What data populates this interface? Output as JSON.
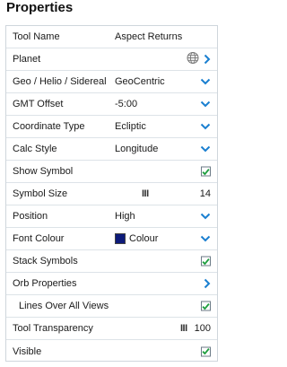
{
  "panel": {
    "title": "Properties",
    "accent_color": "#1a7fd0",
    "check_color": "#1e9e3e"
  },
  "rows": {
    "tool_name": {
      "label": "Tool Name",
      "value": "Aspect Returns"
    },
    "planet": {
      "label": "Planet",
      "icon": "globe-icon"
    },
    "geo": {
      "label": "Geo / Helio / Sidereal",
      "value": "GeoCentric"
    },
    "gmt": {
      "label": "GMT Offset",
      "value": "-5:00"
    },
    "coord": {
      "label": "Coordinate Type",
      "value": "Ecliptic"
    },
    "calc": {
      "label": "Calc Style",
      "value": "Longitude"
    },
    "show_symbol": {
      "label": "Show Symbol",
      "checked": true
    },
    "symbol_size": {
      "label": "Symbol Size",
      "slider_glyph": "III",
      "value": "14"
    },
    "position": {
      "label": "Position",
      "value": "High"
    },
    "font_colour": {
      "label": "Font Colour",
      "value": "Colour",
      "swatch_color": "#0d1b7a"
    },
    "stack_symbols": {
      "label": "Stack Symbols",
      "checked": true
    },
    "orb_properties": {
      "label": "Orb Properties"
    },
    "lines_over": {
      "label": "Lines Over All Views",
      "checked": true
    },
    "transparency": {
      "label": "Tool Transparency",
      "slider_glyph": "III",
      "value": "100"
    },
    "visible": {
      "label": "Visible",
      "checked": true
    }
  }
}
